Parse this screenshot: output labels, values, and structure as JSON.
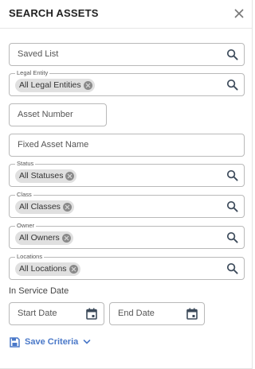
{
  "header": {
    "title": "SEARCH ASSETS"
  },
  "saved_list": {
    "placeholder": "Saved List"
  },
  "legal_entity": {
    "legend": "Legal Entity",
    "chip": "All Legal Entities"
  },
  "asset_number": {
    "placeholder": "Asset Number"
  },
  "fixed_asset_name": {
    "placeholder": "Fixed Asset Name"
  },
  "status": {
    "legend": "Status",
    "chip": "All Statuses"
  },
  "class": {
    "legend": "Class",
    "chip": "All Classes"
  },
  "owner": {
    "legend": "Owner",
    "chip": "All Owners"
  },
  "locations": {
    "legend": "Locations",
    "chip": "All Locations"
  },
  "in_service_date": {
    "label": "In Service Date",
    "start_placeholder": "Start Date",
    "end_placeholder": "End Date"
  },
  "footer": {
    "save_label": "Save Criteria"
  },
  "colors": {
    "accent": "#4a78c8",
    "icon": "#3c4a5a",
    "border": "#b9b9b9",
    "chip_bg": "#e0e0e0"
  }
}
